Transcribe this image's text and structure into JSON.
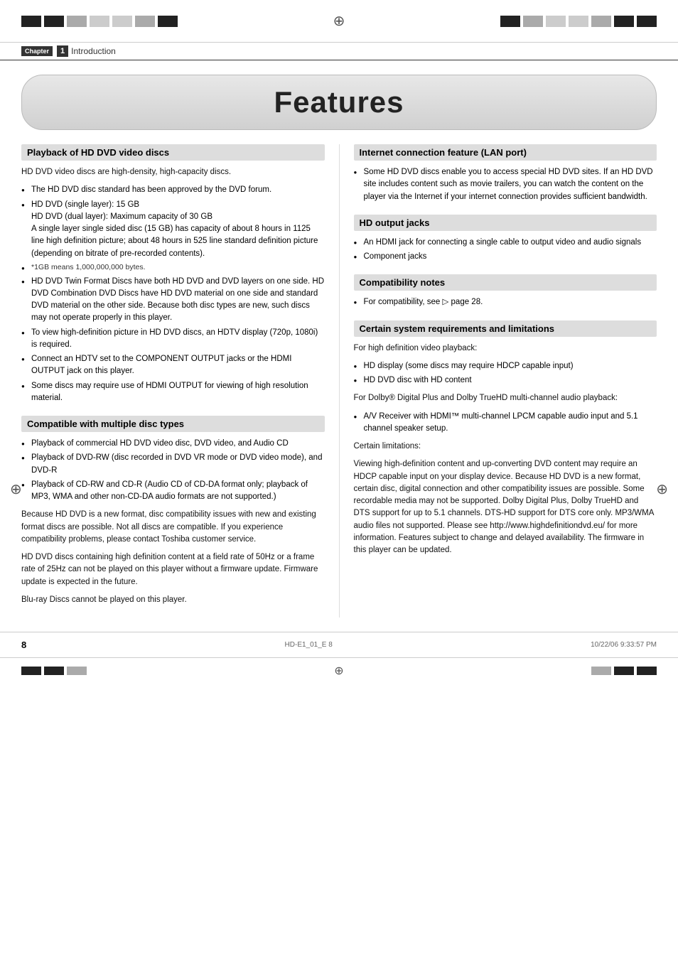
{
  "header": {
    "chapter_label": "Chapter",
    "chapter_number": "1",
    "chapter_title": "Introduction",
    "features_title": "Features"
  },
  "left_column": {
    "section1": {
      "title": "Playback of HD DVD video discs",
      "intro": "HD DVD video discs are high-density, high-capacity discs.",
      "bullets": [
        "The HD DVD disc standard has been approved by the DVD forum.",
        "HD DVD (single layer): 15 GB\nHD DVD (dual layer): Maximum capacity of 30 GB\nA single layer single sided disc (15 GB) has capacity of about 8 hours in 1125 line high definition picture; about 48 hours in 525 line standard definition picture (depending on bitrate of pre-recorded contents).",
        "*1GB means 1,000,000,000 bytes.",
        "HD DVD Twin Format Discs have both HD DVD and DVD layers on one side. HD DVD Combination DVD Discs have HD DVD material on one side and standard DVD material on the other side. Because both disc types are new, such discs may not operate properly in this player.",
        "To view high-definition picture in HD DVD discs, an HDTV display (720p, 1080i) is required.",
        "Connect an HDTV set to the COMPONENT OUTPUT jacks or the HDMI OUTPUT jack on this player.",
        "Some discs may require use of HDMI OUTPUT for viewing of high resolution material."
      ]
    },
    "section2": {
      "title": "Compatible with multiple disc types",
      "bullets": [
        "Playback of commercial HD DVD video disc, DVD video, and Audio CD",
        "Playback of DVD-RW (disc recorded in DVD VR mode or DVD video mode), and DVD-R",
        "Playback of CD-RW and CD-R (Audio CD of CD-DA format only; playback of MP3, WMA and other non-CD-DA audio formats are not supported.)"
      ],
      "body1": "Because HD DVD is a new format, disc compatibility issues with new and existing format discs are possible. Not all discs are compatible. If you experience compatibility problems, please contact Toshiba customer service.",
      "body2": "HD DVD discs containing high definition content at a field rate of 50Hz or a frame rate of 25Hz can not be played on this player without a firmware update. Firmware update is expected in the future.",
      "body3": "Blu-ray Discs cannot be played on this player."
    }
  },
  "right_column": {
    "section1": {
      "title": "Internet connection feature (LAN port)",
      "bullets": [
        "Some HD DVD discs enable you to access special HD DVD sites. If an HD DVD site includes content such as movie trailers, you can watch the content on the player via the Internet if your internet connection provides sufficient bandwidth."
      ]
    },
    "section2": {
      "title": "HD output jacks",
      "bullets": [
        "An HDMI jack for connecting a single cable to output video and audio signals",
        "Component jacks"
      ]
    },
    "section3": {
      "title": "Compatibility notes",
      "bullets": [
        "For compatibility, see ▷ page 28."
      ]
    },
    "section4": {
      "title": "Certain system requirements and limitations",
      "intro": "For high definition video playback:",
      "bullets1": [
        "HD display (some discs may require HDCP capable input)",
        "HD DVD disc with HD content"
      ],
      "intro2": "For Dolby® Digital Plus and Dolby TrueHD multi-channel audio playback:",
      "bullets2": [
        "A/V Receiver with HDMI™ multi-channel LPCM capable audio input and 5.1 channel speaker setup."
      ],
      "limitations_title": "Certain limitations:",
      "limitations_body": "Viewing high-definition content and up-converting DVD content may require an HDCP capable input on your display device. Because HD DVD is a new format, certain disc, digital connection and other compatibility issues are possible.  Some recordable media may not be supported.  Dolby Digital Plus, Dolby TrueHD and DTS support for up to 5.1 channels.  DTS-HD support for DTS core only. MP3/WMA audio files not supported. Please see http://www.highdefinitiondvd.eu/ for more information. Features subject to change and delayed availability.  The firmware in this player can be updated."
    }
  },
  "footer": {
    "page_number": "8",
    "file_info": "HD-E1_01_E  8",
    "date_info": "10/22/06  9:33:57 PM"
  }
}
